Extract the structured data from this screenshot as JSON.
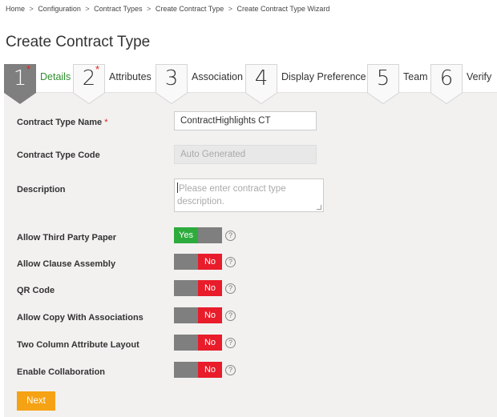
{
  "breadcrumb": [
    "Home",
    "Configuration",
    "Contract Types",
    "Create Contract Type",
    "Create Contract Type Wizard"
  ],
  "breadcrumb_separator": ">",
  "page_title": "Create Contract Type",
  "wizard": {
    "active_step": 1,
    "steps": [
      {
        "number": "1",
        "label": "Details",
        "required": true
      },
      {
        "number": "2",
        "label": "Attributes",
        "required": true
      },
      {
        "number": "3",
        "label": "Association",
        "required": false
      },
      {
        "number": "4",
        "label": "Display Preference",
        "required": false
      },
      {
        "number": "5",
        "label": "Team",
        "required": false
      },
      {
        "number": "6",
        "label": "Verify",
        "required": false
      }
    ],
    "required_mark": "*"
  },
  "form": {
    "contract_type_name": {
      "label": "Contract Type Name",
      "required_mark": "*",
      "value": "ContractHighlights CT"
    },
    "contract_type_code": {
      "label": "Contract Type Code",
      "value": "Auto Generated"
    },
    "description": {
      "label": "Description",
      "placeholder": "Please enter contract type description."
    },
    "toggles": [
      {
        "label": "Allow Third Party Paper",
        "value": "Yes",
        "on": true
      },
      {
        "label": "Allow Clause Assembly",
        "value": "No",
        "on": false
      },
      {
        "label": "QR Code",
        "value": "No",
        "on": false
      },
      {
        "label": "Allow Copy With Associations",
        "value": "No",
        "on": false
      },
      {
        "label": "Two Column Attribute Layout",
        "value": "No",
        "on": false
      },
      {
        "label": "Enable Collaboration",
        "value": "No",
        "on": false
      }
    ],
    "help_icon": "question-circle-icon",
    "help_glyph": "?"
  },
  "buttons": {
    "next": "Next"
  },
  "colors": {
    "active_step_bg": "#7f7f7f",
    "active_step_label": "#2f8f2f",
    "toggle_yes": "#2eab3d",
    "toggle_no": "#e81c2a",
    "toggle_off": "#7f7f7f",
    "next_button": "#f5a214",
    "required": "#e02020",
    "panel_bg": "#f2f1f0"
  }
}
